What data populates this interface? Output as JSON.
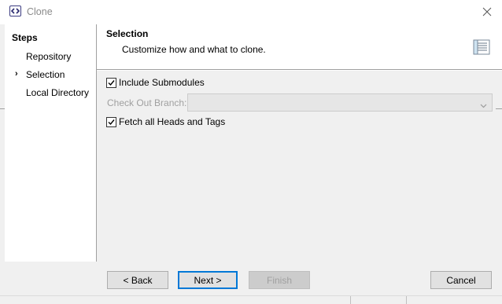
{
  "window": {
    "title": "Clone",
    "app_icon": "eclipse-icon",
    "close_icon": "close-icon"
  },
  "steps": {
    "title": "Steps",
    "items": [
      {
        "label": "Repository",
        "current": false
      },
      {
        "label": "Selection",
        "current": true
      },
      {
        "label": "Local Directory",
        "current": false
      }
    ]
  },
  "header": {
    "title": "Selection",
    "description": "Customize how and what to clone.",
    "icon": "wizard-banner-icon"
  },
  "options": {
    "include_submodules": {
      "label": "Include Submodules",
      "checked": true
    },
    "checkout_branch": {
      "label": "Check Out Branch:",
      "value": "",
      "disabled": true
    },
    "fetch_all": {
      "label": "Fetch all Heads and Tags",
      "checked": true
    }
  },
  "buttons": {
    "back": "< Back",
    "next": "Next >",
    "finish": "Finish",
    "cancel": "Cancel"
  },
  "colors": {
    "accent": "#0078d7",
    "disabled_text": "#a0a0a0"
  }
}
